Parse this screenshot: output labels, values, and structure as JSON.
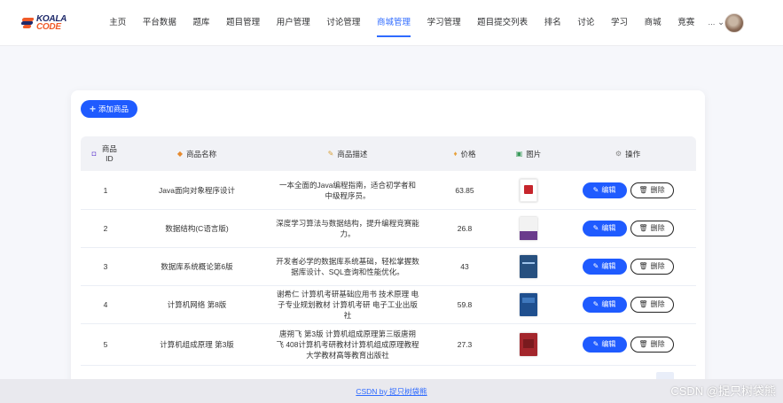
{
  "logo": {
    "line1": "KOALA",
    "line2": "CODE"
  },
  "nav": {
    "items": [
      {
        "label": "主页"
      },
      {
        "label": "平台数据"
      },
      {
        "label": "题库"
      },
      {
        "label": "题目管理"
      },
      {
        "label": "用户管理"
      },
      {
        "label": "讨论管理"
      },
      {
        "label": "商城管理",
        "active": true
      },
      {
        "label": "学习管理"
      },
      {
        "label": "题目提交列表"
      },
      {
        "label": "排名"
      },
      {
        "label": "讨论"
      },
      {
        "label": "学习"
      },
      {
        "label": "商城"
      },
      {
        "label": "竞赛"
      }
    ],
    "more_label": "... ⌄"
  },
  "toolbar": {
    "add_label": "添加商品",
    "add_icon": "+"
  },
  "table": {
    "headers": {
      "id": "商品ID",
      "name": "商品名称",
      "desc": "商品描述",
      "price": "价格",
      "image": "图片",
      "ops": "操作"
    },
    "header_icons": {
      "id": "◘",
      "name": "◆",
      "desc": "✎",
      "price": "♦",
      "image": "▣",
      "ops": "⚙"
    },
    "rows": [
      {
        "id": "1",
        "name": "Java面向对象程序设计",
        "desc": "一本全面的Java编程指南，适合初学者和中级程序员。",
        "price": "63.85",
        "edit": "编辑",
        "del": "删除",
        "cover_color": "#c6252c",
        "cover_bg": "#ffffff"
      },
      {
        "id": "2",
        "name": "数据结构(C语言版)",
        "desc": "深度学习算法与数据结构，提升编程竞赛能力。",
        "price": "26.8",
        "edit": "编辑",
        "del": "删除",
        "cover_color": "#6a3b8c",
        "cover_bg": "#f2f2f2"
      },
      {
        "id": "3",
        "name": "数据库系统概论第6版",
        "desc": "开发者必学的数据库系统基础，轻松掌握数据库设计、SQL查询和性能优化。",
        "price": "43",
        "edit": "编辑",
        "del": "删除",
        "cover_color": "#1c3d6e",
        "cover_bg": "#27507f"
      },
      {
        "id": "4",
        "name": "计算机网络 第8版",
        "desc": "谢希仁 计算机考研基础应用书 技术原理 电子专业规划教材 计算机考研 电子工业出版社",
        "price": "59.8",
        "edit": "编辑",
        "del": "删除",
        "cover_color": "#12366a",
        "cover_bg": "#1f4f8e"
      },
      {
        "id": "5",
        "name": "计算机组成原理 第3版",
        "desc": "唐朔飞 第3版 计算机组成原理第三版唐朔飞 408计算机考研教材计算机组成原理教程 大学教材高等教育出版社",
        "price": "27.3",
        "edit": "编辑",
        "del": "删除",
        "cover_color": "#8e1f24",
        "cover_bg": "#a3262c"
      }
    ]
  },
  "footer": {
    "link": "CSDN by 捉只树袋熊"
  },
  "watermark": "CSDN @捉只树袋熊",
  "colors": {
    "accent": "#2f6bff",
    "primary_button": "#1f5bff"
  }
}
